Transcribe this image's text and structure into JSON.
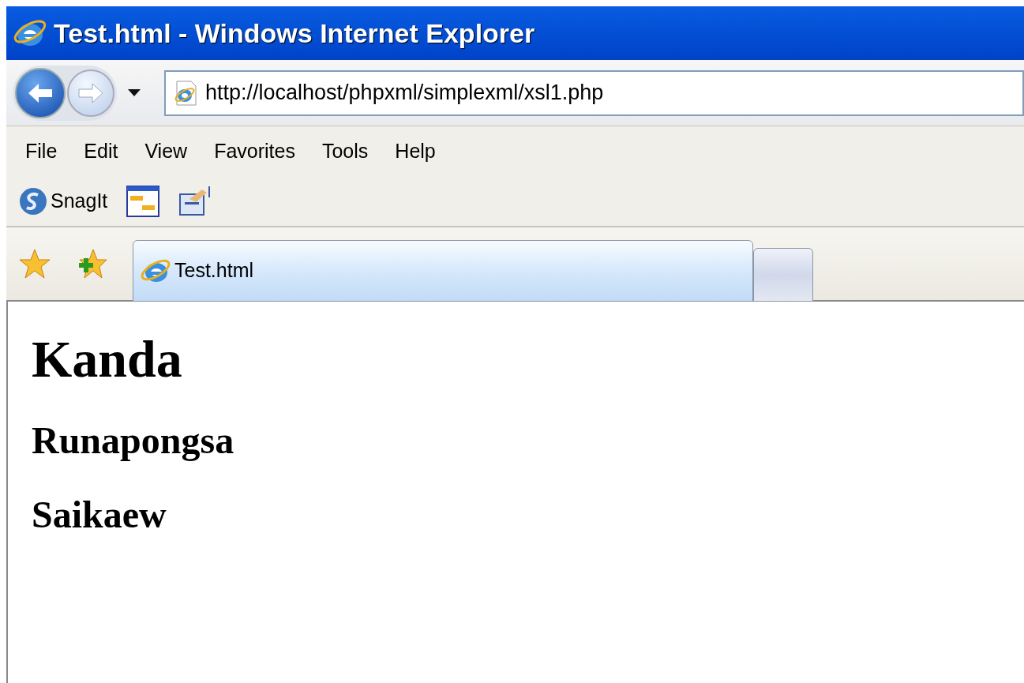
{
  "window": {
    "title": "Test.html - Windows Internet Explorer"
  },
  "address_bar": {
    "url": "http://localhost/phpxml/simplexml/xsl1.php"
  },
  "menu": [
    "File",
    "Edit",
    "View",
    "Favorites",
    "Tools",
    "Help"
  ],
  "toolbar": {
    "snagit_label": "SnagIt"
  },
  "tabs": [
    {
      "label": "Test.html",
      "selected": true
    }
  ],
  "page": {
    "headings": [
      {
        "kind": "h1",
        "text": "Kanda"
      },
      {
        "kind": "h2",
        "text": "Runapongsa"
      },
      {
        "kind": "h2",
        "text": "Saikaew"
      }
    ]
  }
}
